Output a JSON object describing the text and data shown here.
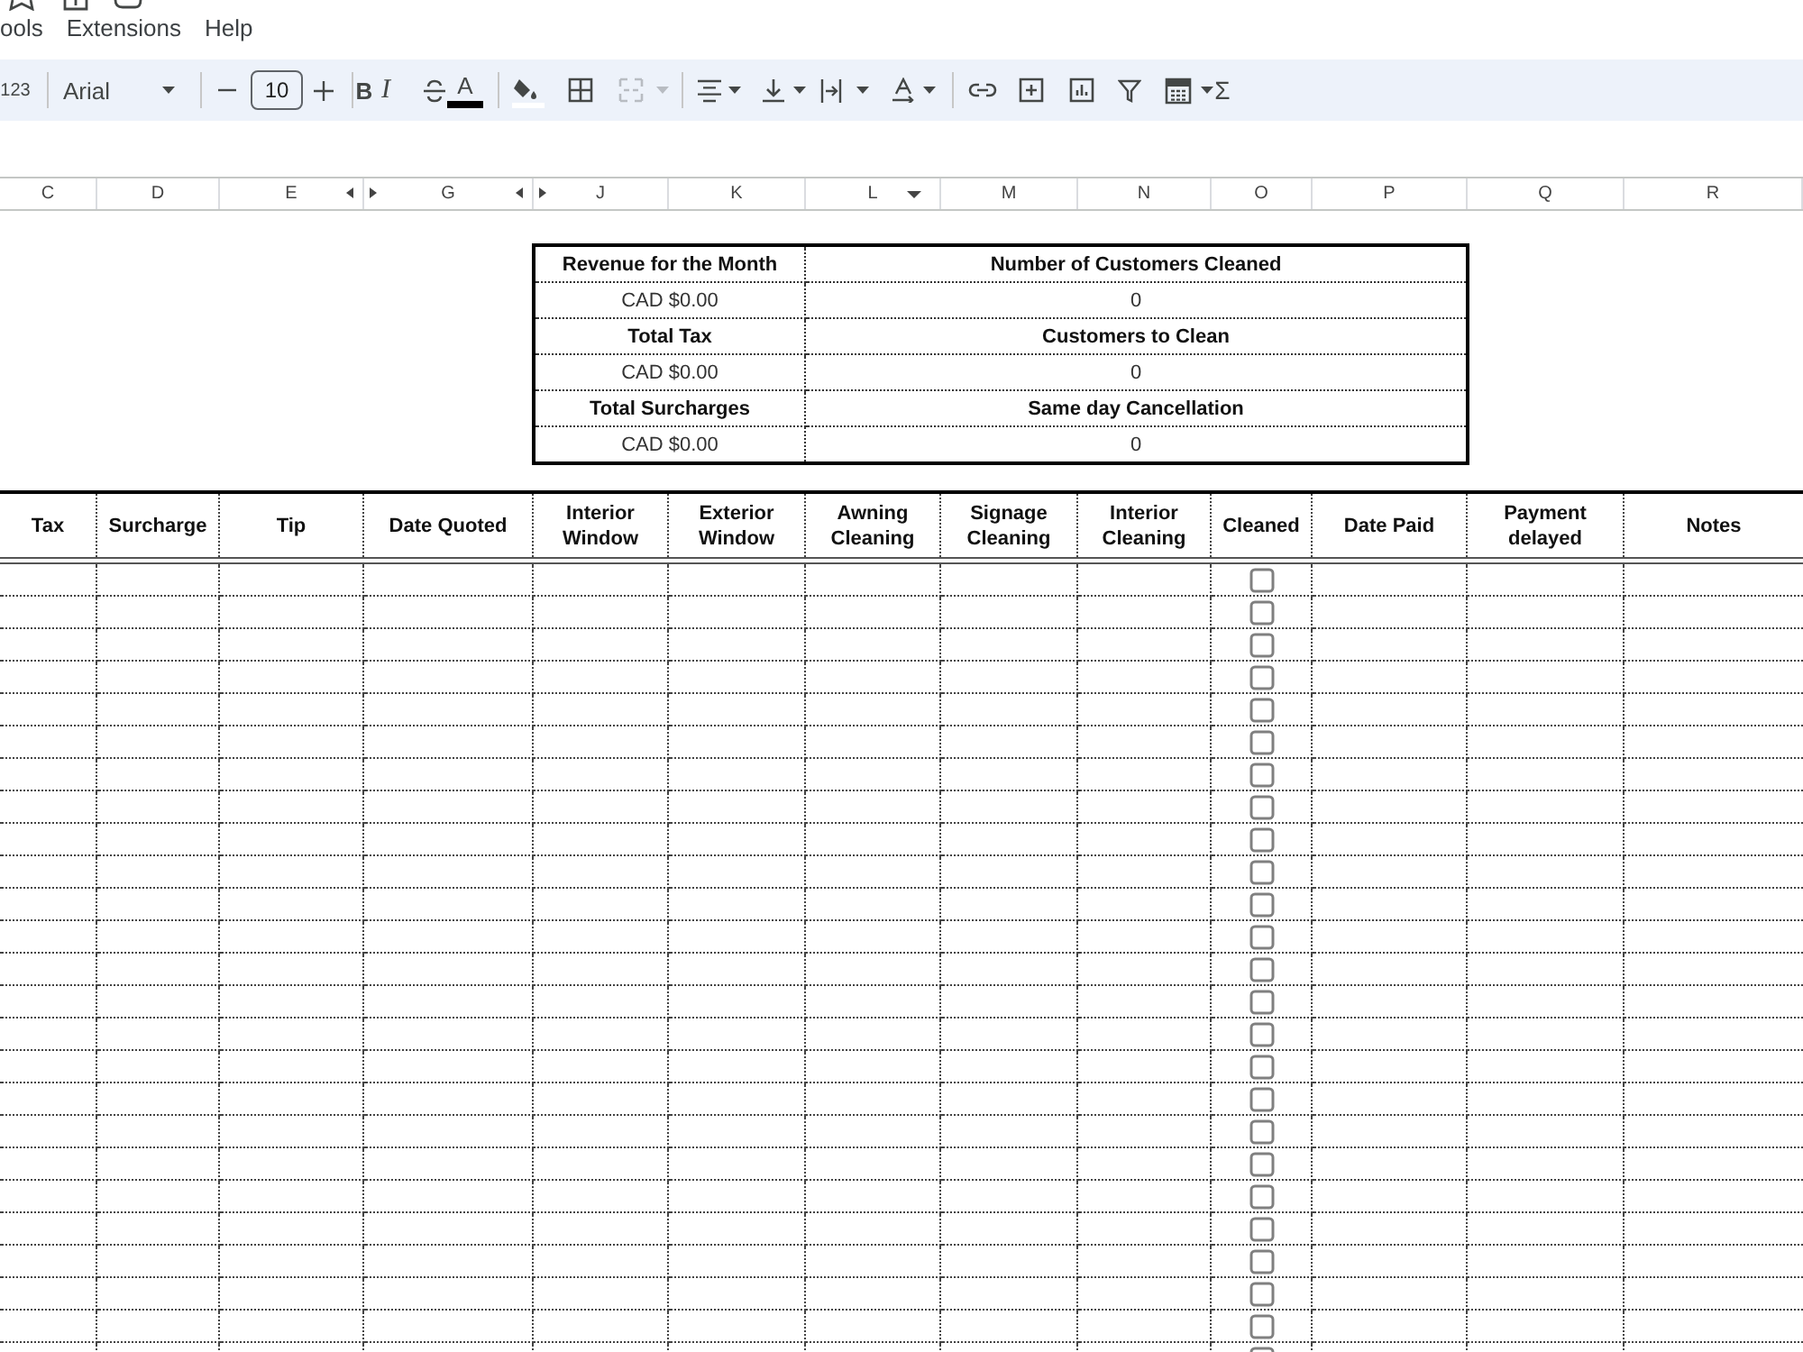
{
  "menu_bar": {
    "items": [
      "ools",
      "Extensions",
      "Help"
    ]
  },
  "toolbar": {
    "number_format": "123",
    "font": "Arial",
    "font_size": "10",
    "bold": "B",
    "italic": "I",
    "text_color": "A",
    "functions": "Σ"
  },
  "column_headers": [
    {
      "label": "C",
      "hidden_after": false,
      "dropdown": false
    },
    {
      "label": "D",
      "hidden_after": false,
      "dropdown": false
    },
    {
      "label": "E",
      "hidden_after": true,
      "dropdown": false
    },
    {
      "label": "G",
      "hidden_after": true,
      "dropdown": false
    },
    {
      "label": "J",
      "hidden_after": false,
      "dropdown": false
    },
    {
      "label": "K",
      "hidden_after": false,
      "dropdown": false
    },
    {
      "label": "L",
      "hidden_after": false,
      "dropdown": true
    },
    {
      "label": "M",
      "hidden_after": false,
      "dropdown": false
    },
    {
      "label": "N",
      "hidden_after": false,
      "dropdown": false
    },
    {
      "label": "O",
      "hidden_after": false,
      "dropdown": false
    },
    {
      "label": "P",
      "hidden_after": false,
      "dropdown": false
    },
    {
      "label": "Q",
      "hidden_after": false,
      "dropdown": false
    },
    {
      "label": "R",
      "hidden_after": false,
      "dropdown": false
    }
  ],
  "summary": {
    "rows": [
      {
        "kind": "label",
        "cells": [
          "Revenue for the Month",
          "Number of Customers Cleaned"
        ]
      },
      {
        "kind": "value",
        "cells": [
          "CAD $0.00",
          "0"
        ]
      },
      {
        "kind": "label",
        "cells": [
          "Total Tax",
          "Customers to Clean"
        ]
      },
      {
        "kind": "value",
        "cells": [
          "CAD $0.00",
          "0"
        ]
      },
      {
        "kind": "label",
        "cells": [
          "Total Surcharges",
          "Same day Cancellation"
        ]
      },
      {
        "kind": "value",
        "cells": [
          "CAD $0.00",
          "0"
        ]
      }
    ]
  },
  "table": {
    "columns": [
      {
        "label": "Tax",
        "kind": "text"
      },
      {
        "label": "Surcharge",
        "kind": "text"
      },
      {
        "label": "Tip",
        "kind": "text"
      },
      {
        "label": "Date Quoted",
        "kind": "text"
      },
      {
        "label": "Interior Window",
        "kind": "text"
      },
      {
        "label": "Exterior Window",
        "kind": "text"
      },
      {
        "label": "Awning Cleaning",
        "kind": "text"
      },
      {
        "label": "Signage Cleaning",
        "kind": "text"
      },
      {
        "label": "Interior Cleaning",
        "kind": "text"
      },
      {
        "label": "Cleaned",
        "kind": "checkbox"
      },
      {
        "label": "Date Paid",
        "kind": "text"
      },
      {
        "label": "Payment delayed",
        "kind": "text"
      },
      {
        "label": "Notes",
        "kind": "text"
      }
    ],
    "rows": [
      {
        "cleaned": false
      },
      {
        "cleaned": false
      },
      {
        "cleaned": false
      },
      {
        "cleaned": false
      },
      {
        "cleaned": false
      },
      {
        "cleaned": false
      },
      {
        "cleaned": false
      },
      {
        "cleaned": false
      },
      {
        "cleaned": false
      },
      {
        "cleaned": false
      },
      {
        "cleaned": false
      },
      {
        "cleaned": false
      },
      {
        "cleaned": false
      },
      {
        "cleaned": false
      },
      {
        "cleaned": false
      },
      {
        "cleaned": false
      },
      {
        "cleaned": false
      },
      {
        "cleaned": false
      },
      {
        "cleaned": false
      },
      {
        "cleaned": false
      },
      {
        "cleaned": false
      },
      {
        "cleaned": false
      },
      {
        "cleaned": false
      },
      {
        "cleaned": false
      },
      {
        "cleaned": false
      }
    ]
  }
}
